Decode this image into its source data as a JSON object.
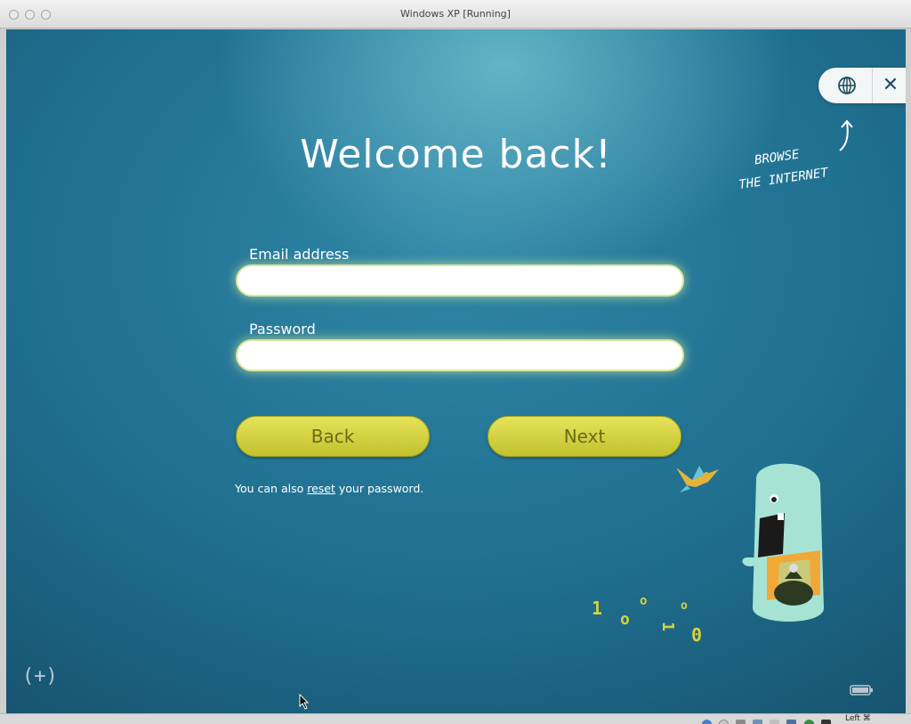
{
  "window": {
    "title": "Windows XP [Running]"
  },
  "top_controls": {
    "globe_icon": "globe-icon",
    "close_symbol": "✕"
  },
  "browse_note": {
    "line1": "BROWSE",
    "line2": "THE INTERNET"
  },
  "heading": "Welcome back!",
  "form": {
    "email_label": "Email address",
    "email_value": "",
    "password_label": "Password",
    "password_value": ""
  },
  "buttons": {
    "back": "Back",
    "next": "Next"
  },
  "reset": {
    "prefix": "You can also ",
    "link": "reset",
    "suffix": " your password."
  },
  "bottom_left_icon": "(+)",
  "binary_digits": [
    "1",
    "o",
    "o",
    "1",
    "o",
    "0"
  ],
  "statusbar": {
    "host_key": "Left ⌘"
  },
  "colors": {
    "background": "#1f6e8e",
    "button": "#d4d240",
    "field_glow": "#d9e79a",
    "binary": "#d8d23a"
  }
}
